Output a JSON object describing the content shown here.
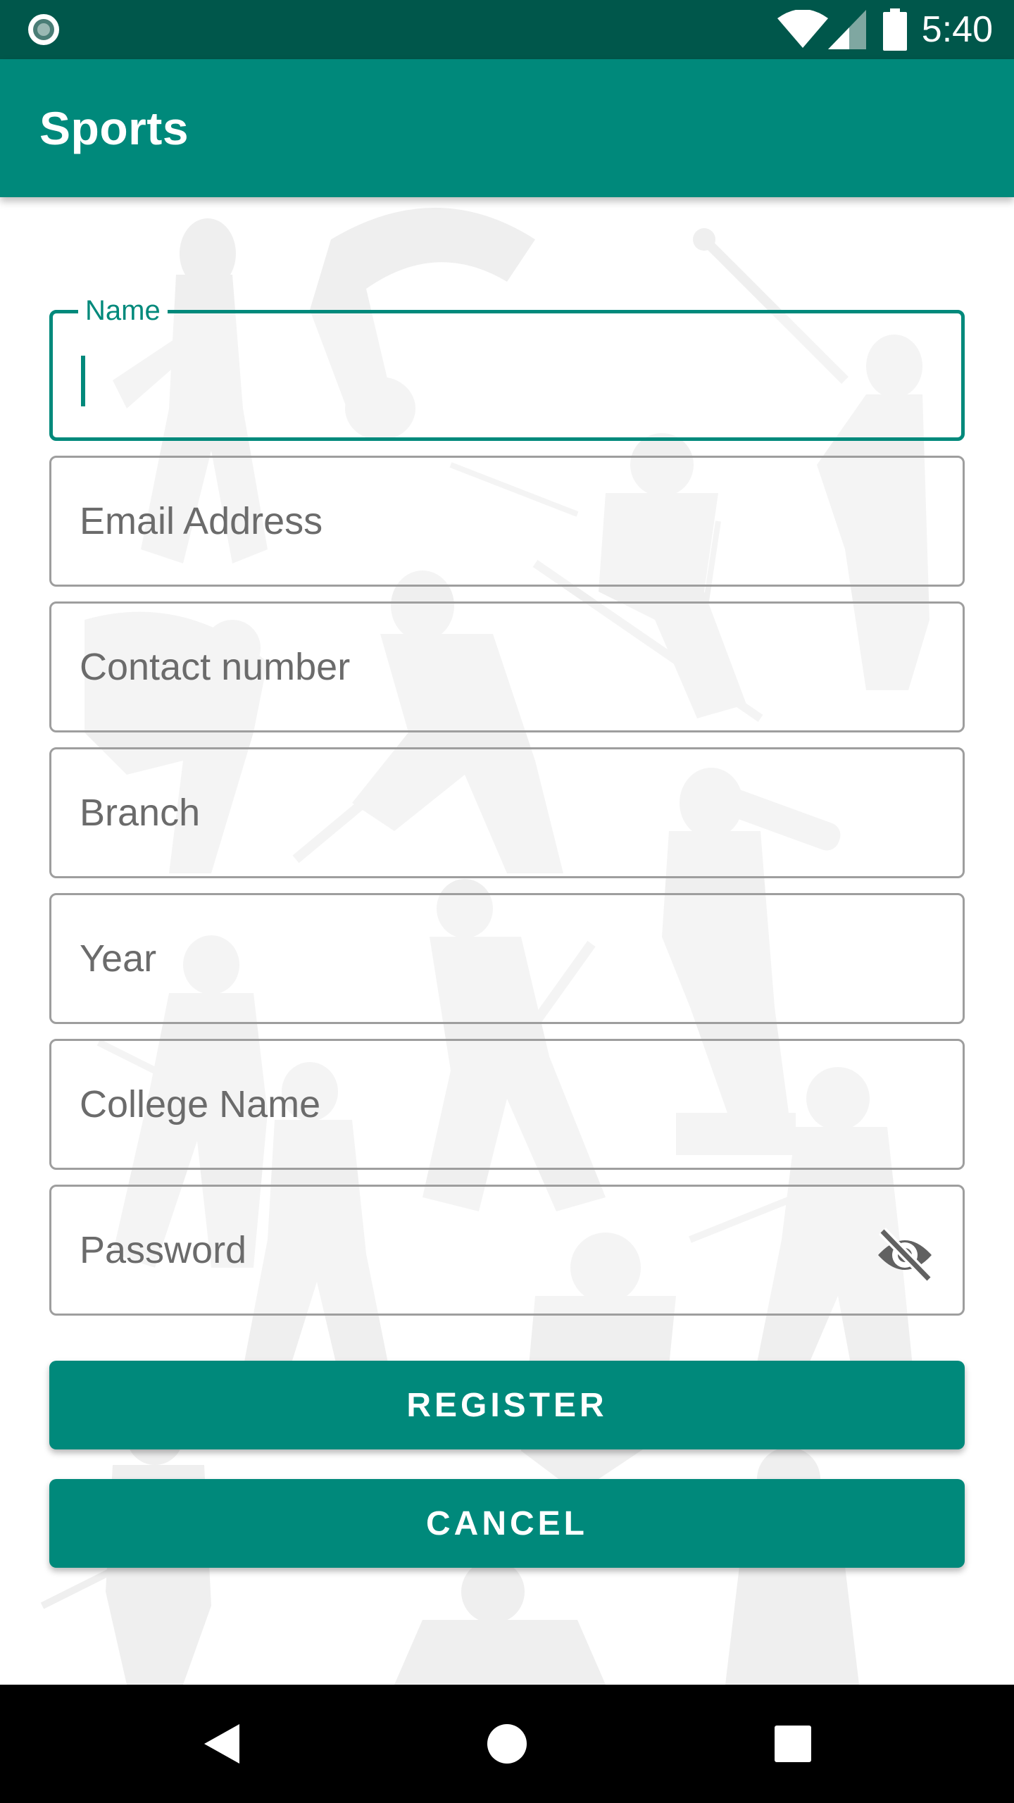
{
  "status_bar": {
    "time": "5:40",
    "icons": [
      "notification-dot-icon",
      "wifi-icon",
      "cell-signal-icon",
      "battery-icon"
    ]
  },
  "app_bar": {
    "title": "Sports"
  },
  "form": {
    "fields": [
      {
        "label": "Name",
        "value": "",
        "focused": true
      },
      {
        "label": "Email Address",
        "value": ""
      },
      {
        "label": "Contact number",
        "value": ""
      },
      {
        "label": "Branch",
        "value": ""
      },
      {
        "label": "Year",
        "value": ""
      },
      {
        "label": "College Name",
        "value": ""
      },
      {
        "label": "Password",
        "value": "",
        "trailing_icon": "visibility-off-icon"
      }
    ],
    "register_label": "REGISTER",
    "cancel_label": "CANCEL"
  },
  "nav_bar": {
    "icons": [
      "back-icon",
      "home-icon",
      "recents-icon"
    ]
  },
  "colors": {
    "primary": "#00897b",
    "primary_dark": "#00574b",
    "background_art": "#efefef"
  }
}
